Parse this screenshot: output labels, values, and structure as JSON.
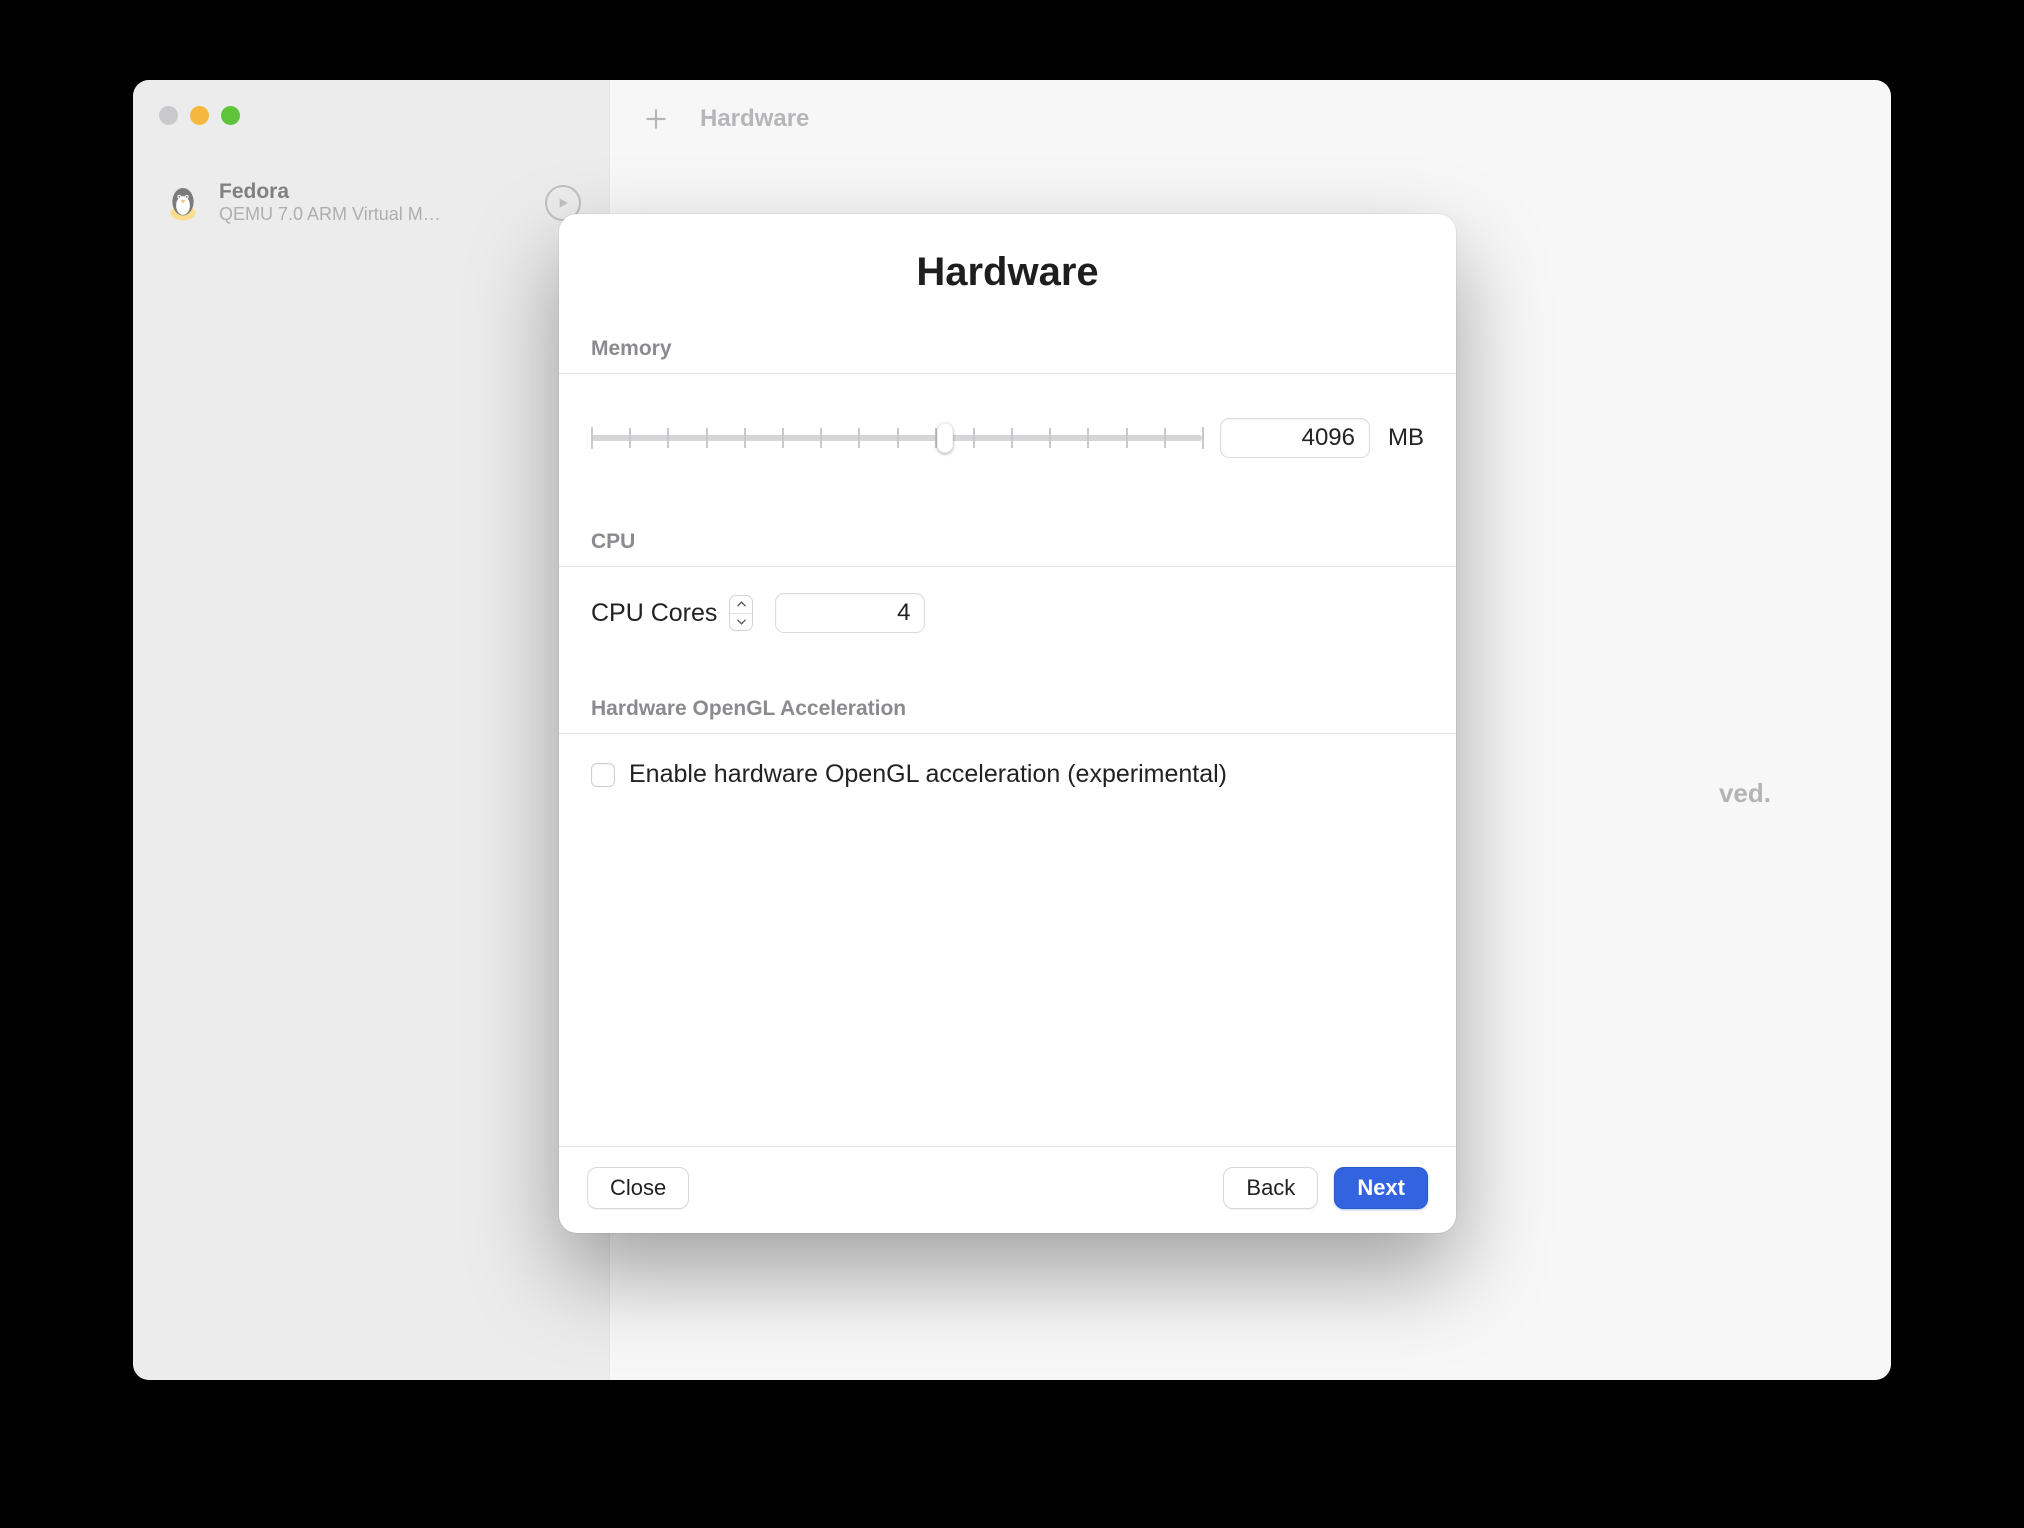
{
  "toolbar": {
    "title": "Hardware"
  },
  "sidebar": {
    "vm": {
      "name": "Fedora",
      "subtitle": "QEMU 7.0 ARM Virtual M…"
    }
  },
  "background": {
    "hint_tail": "ved."
  },
  "modal": {
    "title": "Hardware",
    "memory": {
      "label": "Memory",
      "value": "4096",
      "unit": "MB",
      "slider_percent": 58
    },
    "cpu": {
      "label": "CPU",
      "cores_label": "CPU Cores",
      "cores_value": "4"
    },
    "gl": {
      "label": "Hardware OpenGL Acceleration",
      "checkbox_label": "Enable hardware OpenGL acceleration (experimental)",
      "checked": false
    },
    "buttons": {
      "close": "Close",
      "back": "Back",
      "next": "Next"
    }
  }
}
